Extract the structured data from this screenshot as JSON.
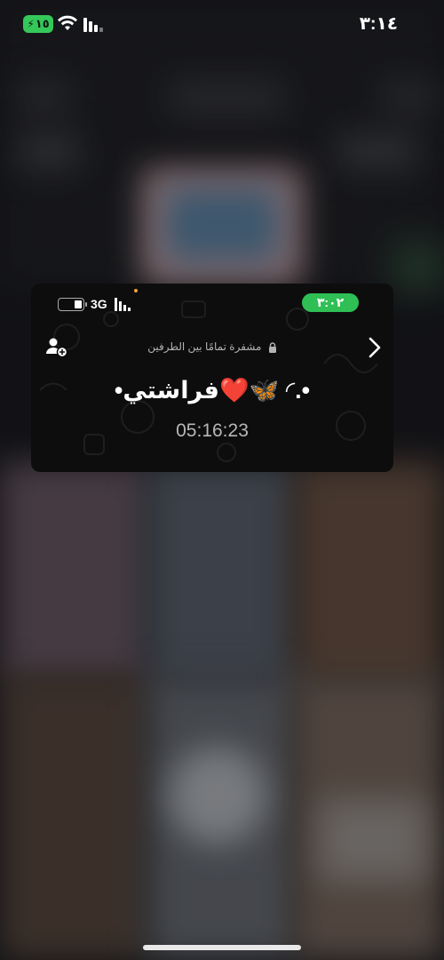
{
  "status_bar": {
    "time": "٣:١٤",
    "battery": "١٥"
  },
  "call_card": {
    "network": "3G",
    "call_time": "٣:٠٢",
    "encryption_text": "مشفرة تمامًا بين الطرفين",
    "contact_name": "•فراشتي❤️🦋 ◜.•",
    "duration": "05:16:23"
  },
  "colors": {
    "battery_green": "#34c759",
    "call_pill_green": "#2fbf55",
    "card_background": "#0d0d0d"
  }
}
